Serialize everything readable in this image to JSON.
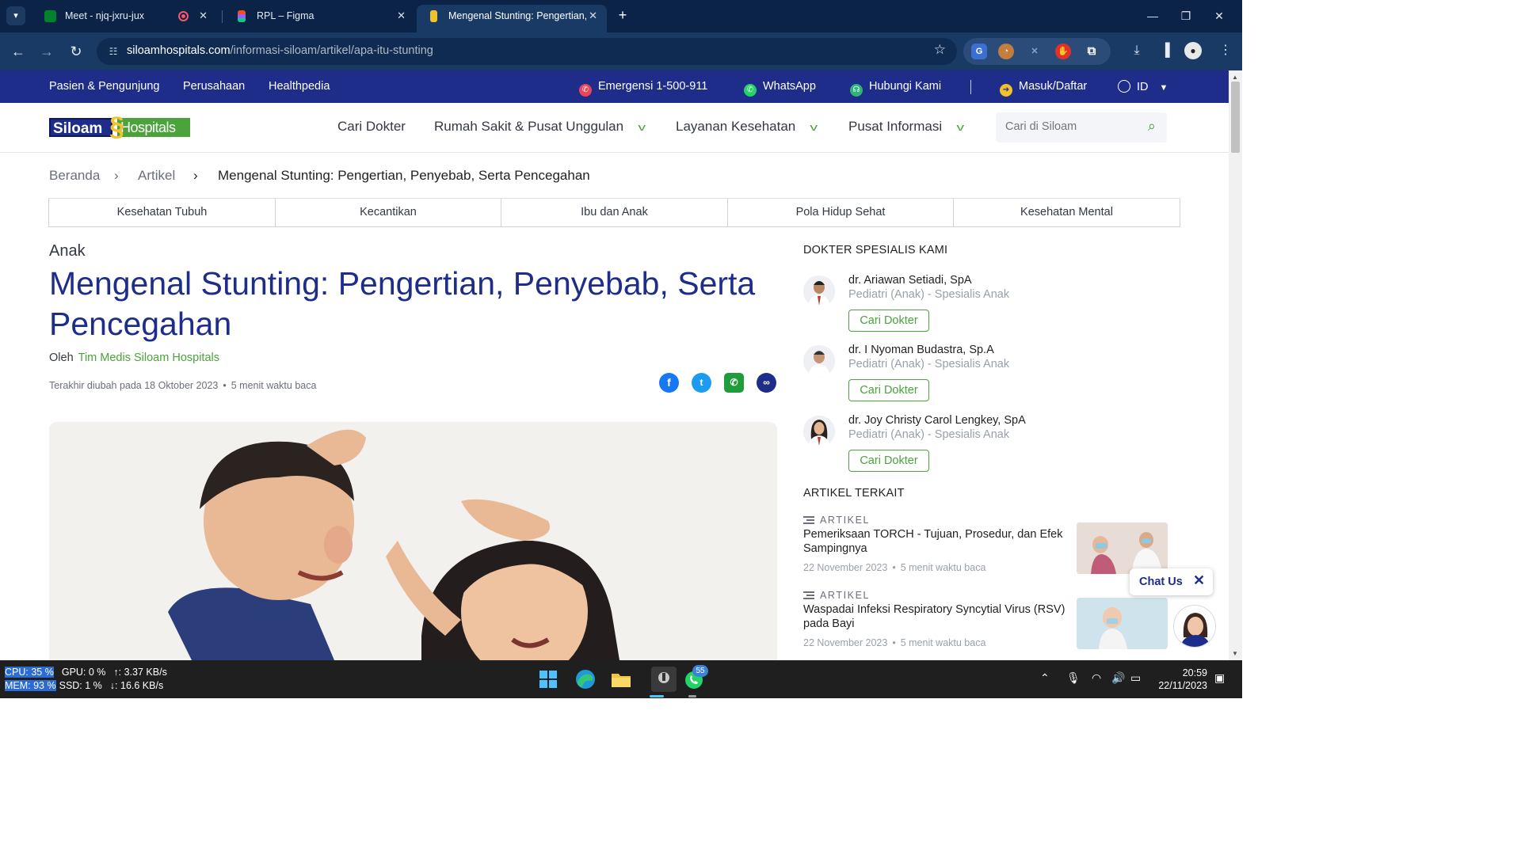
{
  "browser": {
    "tabs": [
      {
        "title": "Meet - njq-jxru-jux",
        "close": "✕"
      },
      {
        "title": "RPL – Figma",
        "close": "✕"
      },
      {
        "title": "Mengenal Stunting: Pengertian,",
        "close": "✕"
      }
    ],
    "new_tab": "+",
    "url_host": "siloamhospitals.com",
    "url_path": "/informasi-siloam/artikel/apa-itu-stunting",
    "window_controls": [
      "—",
      "❐",
      "✕"
    ]
  },
  "topbar": {
    "left": [
      "Pasien & Pengunjung",
      "Perusahaan",
      "Healthpedia"
    ],
    "emergency": "Emergensi 1-500-911",
    "whatsapp": "WhatsApp",
    "contact": "Hubungi Kami",
    "login": "Masuk/Daftar",
    "language": "ID"
  },
  "header": {
    "logo_left": "Siloam",
    "logo_right": "Hospitals",
    "menu": [
      "Cari Dokter",
      "Rumah Sakit & Pusat Unggulan",
      "Layanan Kesehatan",
      "Pusat Informasi"
    ],
    "search_placeholder": "Cari di Siloam"
  },
  "breadcrumb": {
    "items": [
      "Beranda",
      "Artikel",
      "Mengenal Stunting: Pengertian, Penyebab, Serta Pencegahan"
    ],
    "separator": "›"
  },
  "categories": [
    "Kesehatan Tubuh",
    "Kecantikan",
    "Ibu dan Anak",
    "Pola Hidup Sehat",
    "Kesehatan Mental"
  ],
  "article": {
    "kicker": "Anak",
    "title": "Mengenal Stunting: Pengertian, Penyebab, Serta Pencegahan",
    "by_label": "Oleh",
    "author": "Tim Medis Siloam Hospitals",
    "updated": "Terakhir diubah pada 18 Oktober 2023",
    "read_time": "5 menit waktu baca",
    "share": [
      "facebook-icon",
      "twitter-icon",
      "whatsapp-icon",
      "link-icon"
    ]
  },
  "sidebar": {
    "doctors_heading": "DOKTER SPESIALIS KAMI",
    "doctors": [
      {
        "name": "dr. Ariawan Setiadi, SpA",
        "specialty": "Pediatri (Anak) - Spesialis Anak",
        "button": "Cari Dokter"
      },
      {
        "name": "dr. I Nyoman Budastra, Sp.A",
        "specialty": "Pediatri (Anak) - Spesialis Anak",
        "button": "Cari Dokter"
      },
      {
        "name": "dr. Joy Christy Carol Lengkey, SpA",
        "specialty": "Pediatri (Anak) - Spesialis Anak",
        "button": "Cari Dokter"
      }
    ],
    "related_heading": "ARTIKEL TERKAIT",
    "related": [
      {
        "tag": "ARTIKEL",
        "title": "Pemeriksaan TORCH - Tujuan, Prosedur, dan Efek Sampingnya",
        "date": "22 November 2023",
        "read_time": "5 menit waktu baca"
      },
      {
        "tag": "ARTIKEL",
        "title": "Waspadai Infeksi Respiratory Syncytial Virus (RSV) pada Bayi",
        "date": "22 November 2023",
        "read_time": "5 menit waktu baca"
      }
    ],
    "chat_label": "Chat Us"
  },
  "taskbar": {
    "cpu": "CPU: 35 %",
    "gpu": "GPU: 0 %",
    "up": "↑: 3.37 KB/s",
    "mem": "MEM: 93 %",
    "ssd": "SSD: 1 %",
    "down": "↓: 16.6 KB/s",
    "whatsapp_badge": "55",
    "time": "20:59",
    "date": "22/11/2023"
  },
  "colors": {
    "brand_blue": "#1e2d8a",
    "brand_green": "#4aa33b",
    "browser_bg": "#0b2347"
  }
}
